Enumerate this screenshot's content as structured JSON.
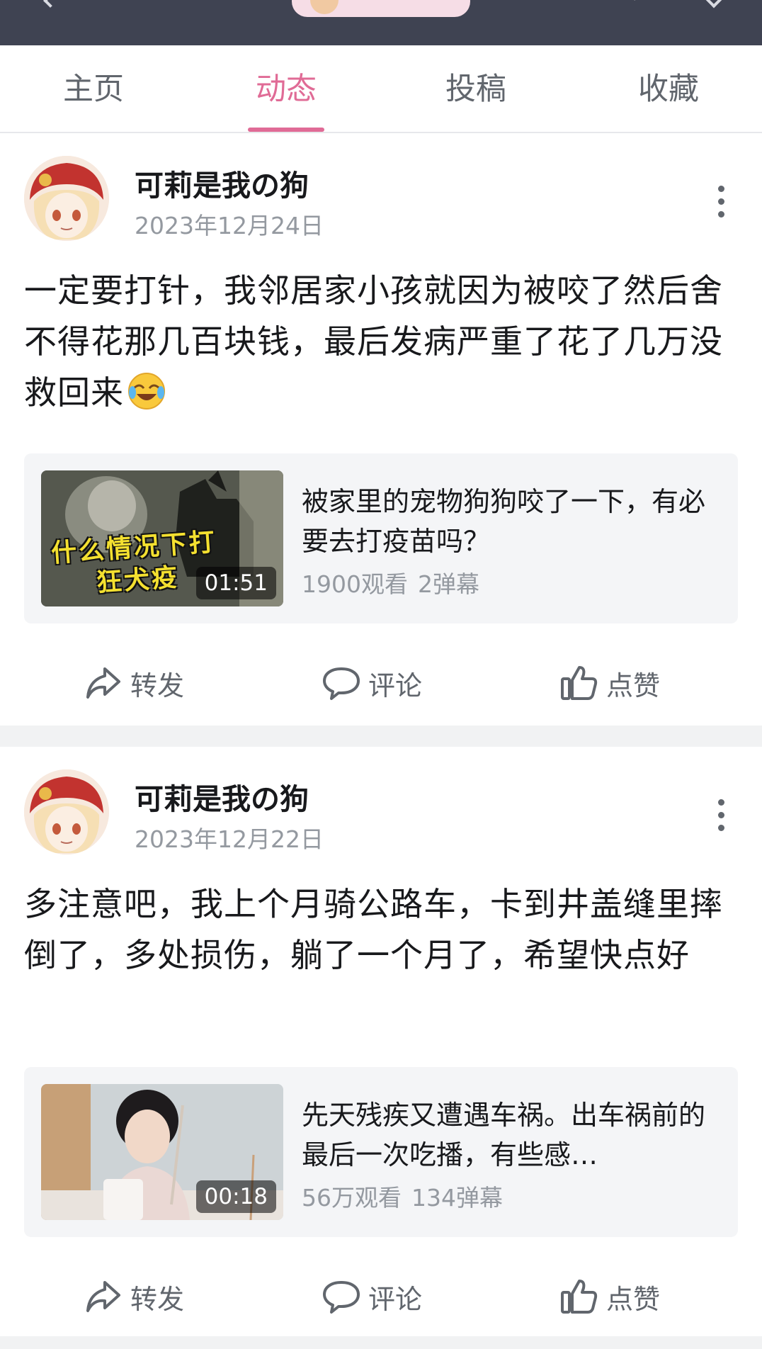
{
  "tabs": [
    {
      "label": "主页",
      "active": false
    },
    {
      "label": "动态",
      "active": true
    },
    {
      "label": "投稿",
      "active": false
    },
    {
      "label": "收藏",
      "active": false
    }
  ],
  "colors": {
    "accent": "#e06b96",
    "header_bg": "#3f4352",
    "card_bg": "#f4f5f7",
    "secondary_text": "#9499a0"
  },
  "icons": [
    "back-arrow-icon",
    "search-icon",
    "more-icon",
    "kebab-menu-icon",
    "share-icon",
    "comment-icon",
    "like-icon"
  ],
  "posts": [
    {
      "author": "可莉是我の狗",
      "date": "2023年12月24日",
      "text": "一定要打针，我邻居家小孩就因为被咬了然后舍不得花那几百块钱，最后发病严重了花了几万没救回来",
      "emoji": "crying-laughing-face",
      "video": {
        "thumbnail_caption_line1": "什么情况下打",
        "thumbnail_caption_line2": "狂犬疫",
        "duration": "01:51",
        "title": "被家里的宠物狗狗咬了一下，有必要去打疫苗吗？",
        "views": "1900观看",
        "danmaku": "2弹幕"
      },
      "actions": {
        "share": "转发",
        "comment": "评论",
        "like": "点赞"
      }
    },
    {
      "author": "可莉是我の狗",
      "date": "2023年12月22日",
      "text": "多注意吧，我上个月骑公路车，卡到井盖缝里摔倒了，多处损伤，躺了一个月了，希望快点好",
      "video": {
        "duration": "00:18",
        "title": "先天残疾又遭遇车祸。出车祸前的最后一次吃播，有些感…",
        "views": "56万观看",
        "danmaku": "134弹幕"
      },
      "actions": {
        "share": "转发",
        "comment": "评论",
        "like": "点赞"
      }
    }
  ]
}
